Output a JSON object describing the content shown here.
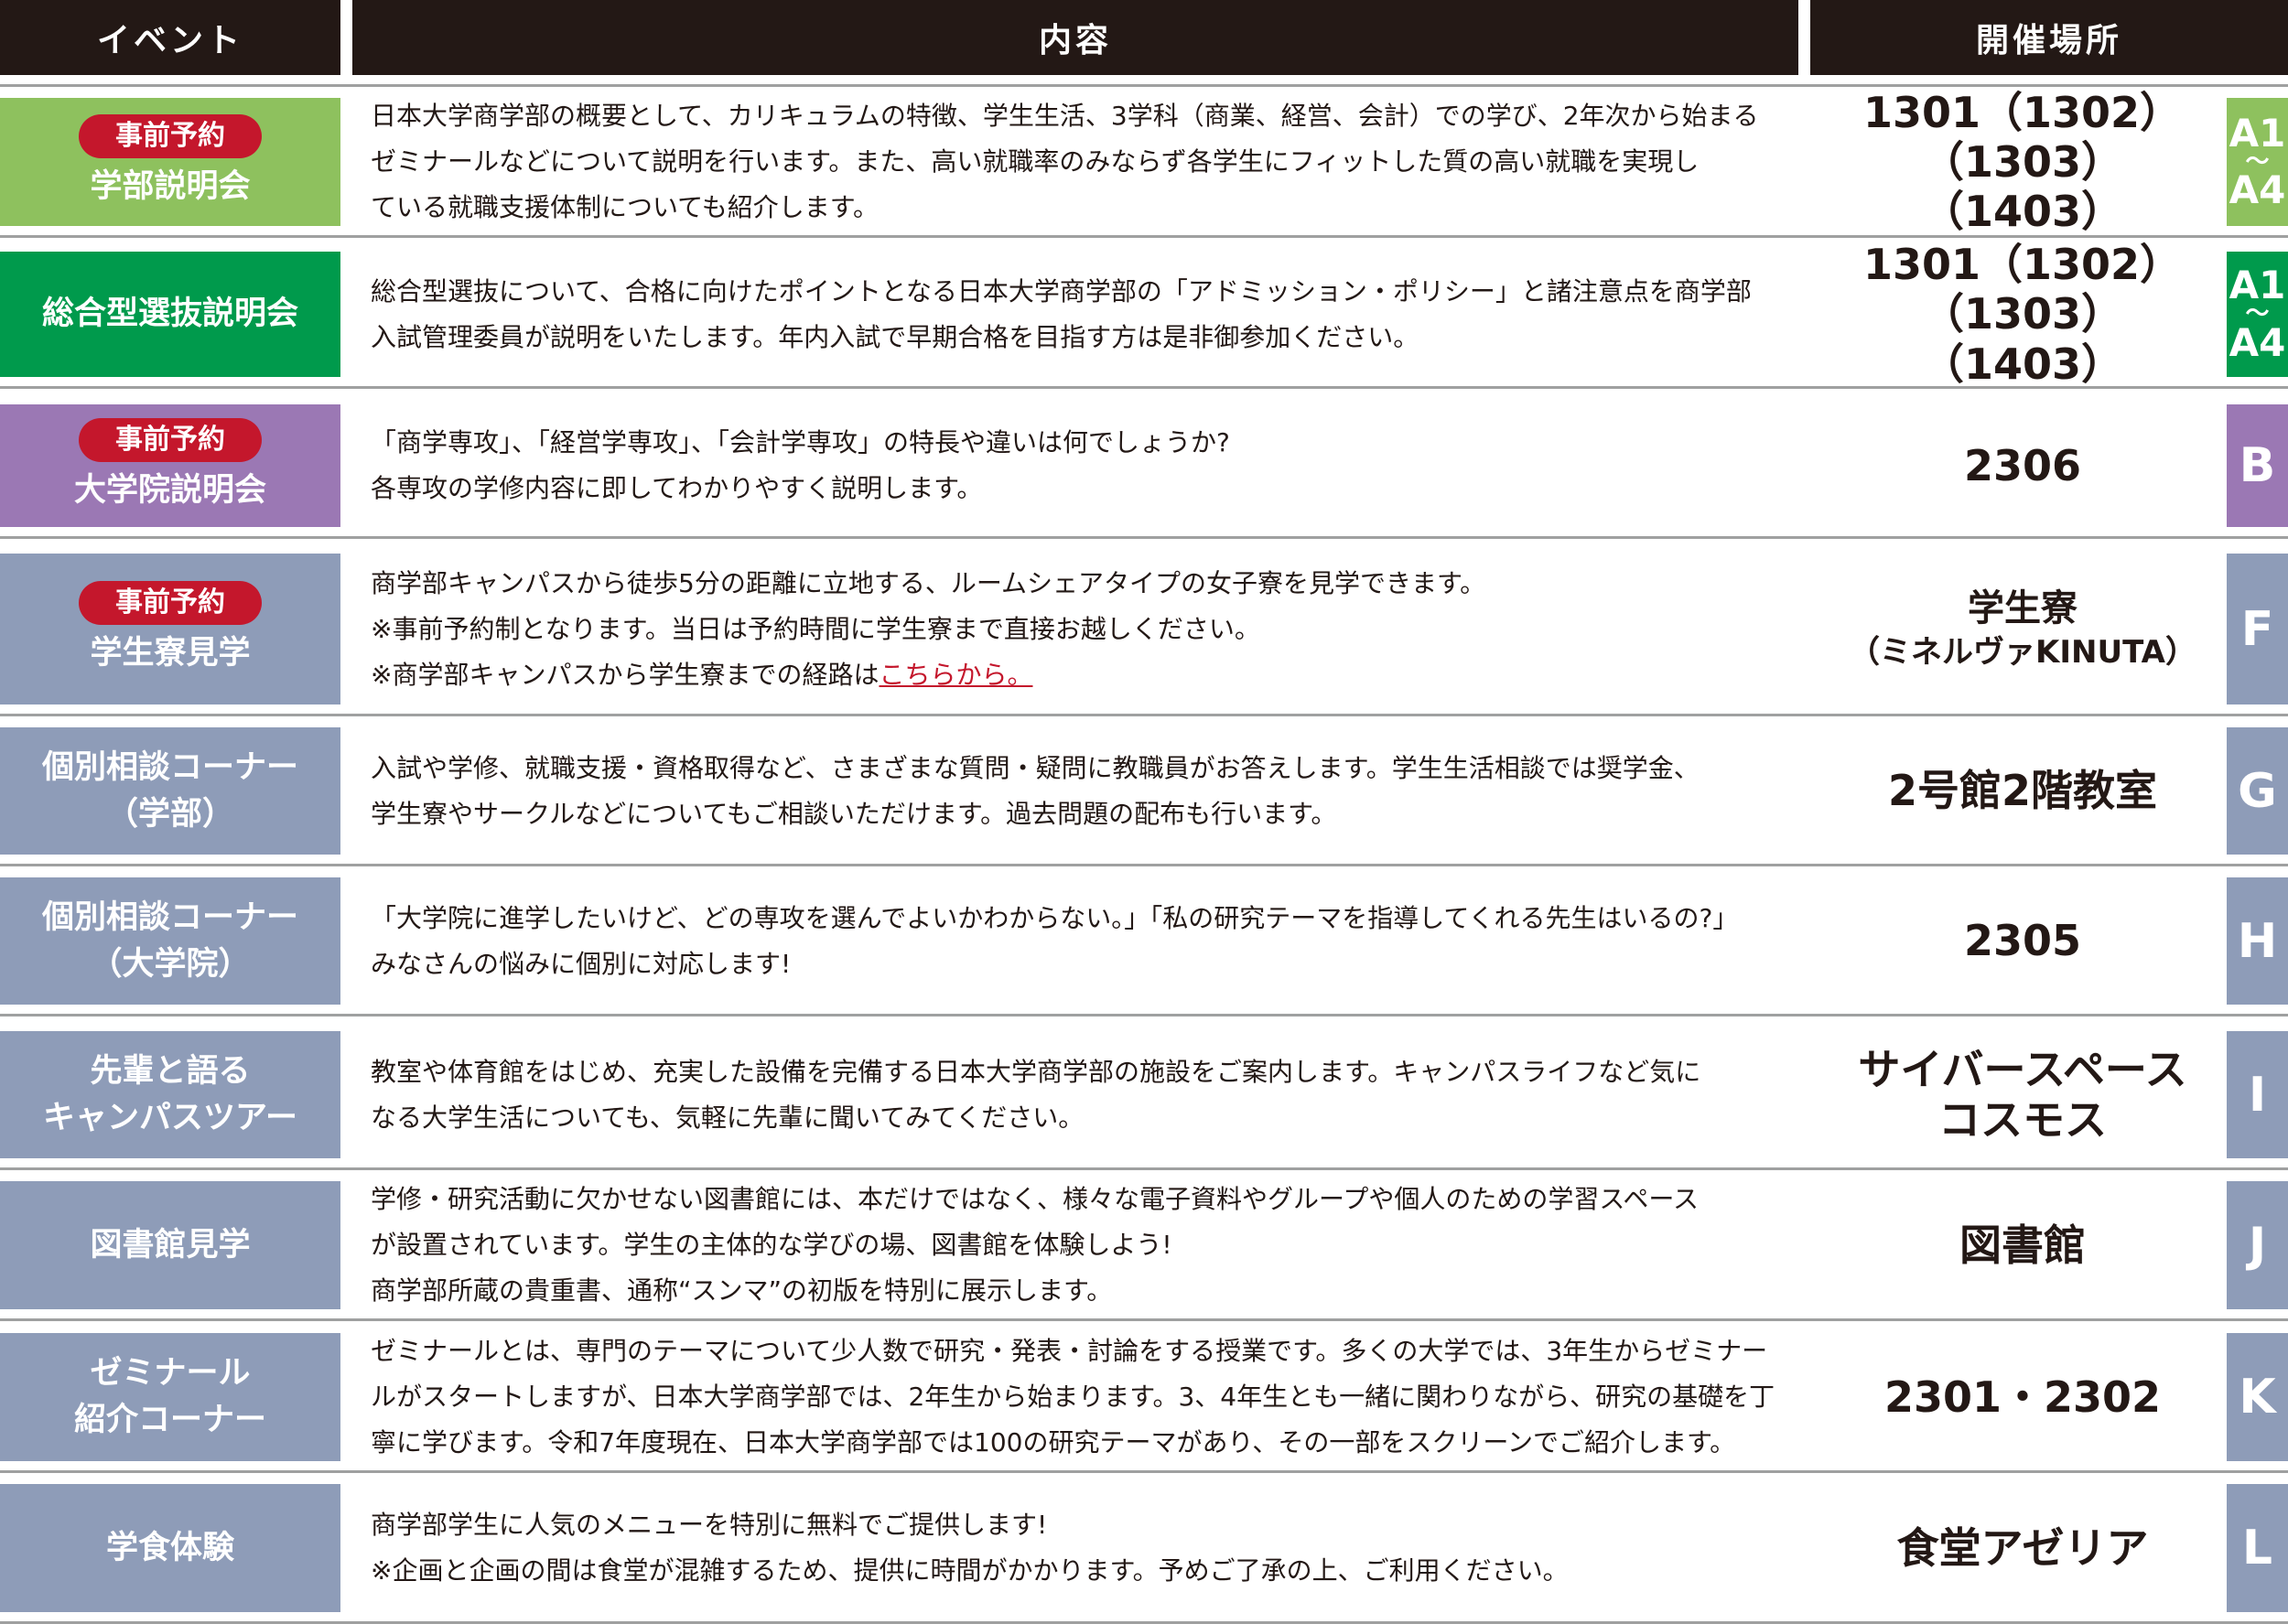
{
  "header": {
    "event": "イベント",
    "content": "内容",
    "venue": "開催場所"
  },
  "colors": {
    "header_bg": "#231815",
    "light_green": "#8ec15e",
    "green": "#009a4c",
    "purple": "#9b78b4",
    "blue_gray": "#8e9cb8",
    "badge_red": "#c4172c"
  },
  "rows": [
    {
      "badge": "事前予約",
      "event_lines": [
        "学部説明会"
      ],
      "content_lines": [
        "日本大学商学部の概要として、カリキュラムの特徴、学生生活、3学科（商業、経営、会計）での学び、2年次から始まる",
        "ゼミナールなどについて説明を行います。また、高い就職率のみならず各学生にフィットした質の高い就職を実現し",
        "ている就職支援体制についても紹介します。"
      ],
      "venue_lines": [
        "1301（1302）（1303）",
        "（1403）"
      ],
      "letter_top": "A1",
      "letter_sep": "～",
      "letter_bottom": "A4",
      "color": "#8ec15e"
    },
    {
      "event_lines": [
        "総合型選抜説明会"
      ],
      "content_lines": [
        "総合型選抜について、合格に向けたポイントとなる日本大学商学部の「アドミッション・ポリシー」と諸注意点を商学部",
        "入試管理委員が説明をいたします。年内入試で早期合格を目指す方は是非御参加ください。"
      ],
      "venue_lines": [
        "1301（1302）（1303）",
        "（1403）"
      ],
      "letter_top": "A1",
      "letter_sep": "～",
      "letter_bottom": "A4",
      "color": "#009a4c"
    },
    {
      "badge": "事前予約",
      "event_lines": [
        "大学院説明会"
      ],
      "content_lines": [
        "「商学専攻」、「経営学専攻」、「会計学専攻」の特長や違いは何でしょうか?",
        "各専攻の学修内容に即してわかりやすく説明します。"
      ],
      "venue_lines": [
        "2306"
      ],
      "letter": "B",
      "color": "#9b78b4"
    },
    {
      "badge": "事前予約",
      "event_lines": [
        "学生寮見学"
      ],
      "content_lines": [
        "商学部キャンパスから徒歩5分の距離に立地する、ルームシェアタイプの女子寮を見学できます。",
        "※事前予約制となります。当日は予約時間に学生寮まで直接お越しください。",
        "※商学部キャンパスから学生寮までの経路は"
      ],
      "content_link": "こちらから。",
      "venue_lines": [
        "学生寮"
      ],
      "venue_sub": "（ミネルヴァKINUTA）",
      "letter": "F",
      "color": "#8e9cb8"
    },
    {
      "event_lines": [
        "個別相談コーナー",
        "（学部）"
      ],
      "content_lines": [
        "入試や学修、就職支援・資格取得など、さまざまな質問・疑問に教職員がお答えします。学生生活相談では奨学金、",
        "学生寮やサークルなどについてもご相談いただけます。過去問題の配布も行います。"
      ],
      "venue_lines": [
        "2号館2階教室"
      ],
      "letter": "G",
      "color": "#8e9cb8"
    },
    {
      "event_lines": [
        "個別相談コーナー",
        "（大学院）"
      ],
      "content_lines": [
        "「大学院に進学したいけど、どの専攻を選んでよいかわからない。」「私の研究テーマを指導してくれる先生はいるの?」",
        "みなさんの悩みに個別に対応します!"
      ],
      "venue_lines": [
        "2305"
      ],
      "letter": "H",
      "color": "#8e9cb8"
    },
    {
      "event_lines": [
        "先輩と語る",
        "キャンパスツアー"
      ],
      "content_lines": [
        "教室や体育館をはじめ、充実した設備を完備する日本大学商学部の施設をご案内します。キャンパスライフなど気に",
        "なる大学生活についても、気軽に先輩に聞いてみてください。"
      ],
      "venue_lines": [
        "サイバースペース",
        "コスモス"
      ],
      "letter": "I",
      "color": "#8e9cb8"
    },
    {
      "event_lines": [
        "図書館見学"
      ],
      "content_lines": [
        "学修・研究活動に欠かせない図書館には、本だけではなく、様々な電子資料やグループや個人のための学習スペース",
        "が設置されています。学生の主体的な学びの場、図書館を体験しよう!",
        "商学部所蔵の貴重書、通称“スンマ”の初版を特別に展示します。"
      ],
      "venue_lines": [
        "図書館"
      ],
      "letter": "J",
      "color": "#8e9cb8"
    },
    {
      "event_lines": [
        "ゼミナール",
        "紹介コーナー"
      ],
      "content_lines": [
        "ゼミナールとは、専門のテーマについて少人数で研究・発表・討論をする授業です。多くの大学では、3年生からゼミナー",
        "ルがスタートしますが、日本大学商学部では、2年生から始まります。3、4年生とも一緒に関わりながら、研究の基礎を丁",
        "寧に学びます。令和7年度現在、日本大学商学部では100の研究テーマがあり、その一部をスクリーンでご紹介します。"
      ],
      "venue_lines": [
        "2301・2302"
      ],
      "letter": "K",
      "color": "#8e9cb8"
    },
    {
      "event_lines": [
        "学食体験"
      ],
      "content_lines": [
        "商学部学生に人気のメニューを特別に無料でご提供します!",
        "※企画と企画の間は食堂が混雑するため、提供に時間がかかります。予めご了承の上、ご利用ください。"
      ],
      "venue_lines": [
        "食堂アゼリア"
      ],
      "letter": "L",
      "color": "#8e9cb8"
    }
  ]
}
